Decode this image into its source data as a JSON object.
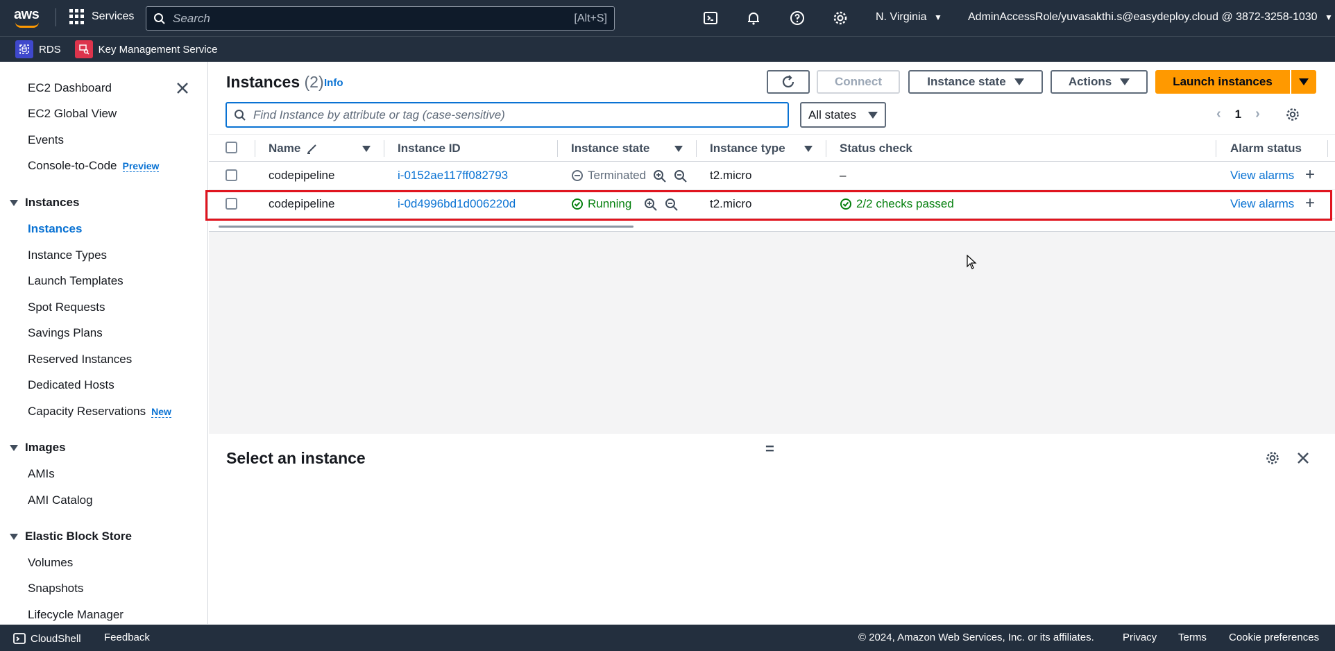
{
  "topnav": {
    "logo_text": "aws",
    "services_label": "Services",
    "search_placeholder": "Search",
    "search_shortcut": "[Alt+S]",
    "region": "N. Virginia",
    "account": "AdminAccessRole/yuvasakthi.s@easydeploy.cloud @ 3872-3258-1030"
  },
  "favorites": [
    {
      "label": "RDS",
      "icon": "rds-icon",
      "color": "#3f48cc"
    },
    {
      "label": "Key Management Service",
      "icon": "kms-icon",
      "color": "#dd344c"
    }
  ],
  "sidebar": {
    "top_items": [
      "EC2 Dashboard",
      "EC2 Global View",
      "Events",
      "Console-to-Code"
    ],
    "preview_badge": "Preview",
    "sections": [
      {
        "title": "Instances",
        "items": [
          "Instances",
          "Instance Types",
          "Launch Templates",
          "Spot Requests",
          "Savings Plans",
          "Reserved Instances",
          "Dedicated Hosts",
          "Capacity Reservations"
        ]
      },
      {
        "title": "Images",
        "items": [
          "AMIs",
          "AMI Catalog"
        ]
      },
      {
        "title": "Elastic Block Store",
        "items": [
          "Volumes",
          "Snapshots",
          "Lifecycle Manager"
        ]
      }
    ],
    "new_badge": "New",
    "active_item": "Instances"
  },
  "main": {
    "title": "Instances",
    "count": "(2)",
    "info": "Info",
    "buttons": {
      "connect": "Connect",
      "instance_state": "Instance state",
      "actions": "Actions",
      "launch": "Launch instances"
    },
    "find_placeholder": "Find Instance by attribute or tag (case-sensitive)",
    "state_filter": "All states",
    "page": "1",
    "columns": [
      "Name",
      "Instance ID",
      "Instance state",
      "Instance type",
      "Status check",
      "Alarm status"
    ],
    "rows": [
      {
        "name": "codepipeline",
        "id": "i-0152ae117ff082793",
        "state": "Terminated",
        "type": "t2.micro",
        "status": "–",
        "alarm": "View alarms"
      },
      {
        "name": "codepipeline",
        "id": "i-0d4996bd1d006220d",
        "state": "Running",
        "type": "t2.micro",
        "status": "2/2 checks passed",
        "alarm": "View alarms"
      }
    ],
    "detail_title": "Select an instance",
    "drag_handle": "="
  },
  "footer": {
    "cloudshell": "CloudShell",
    "feedback": "Feedback",
    "copyright": "© 2024, Amazon Web Services, Inc. or its affiliates.",
    "privacy": "Privacy",
    "terms": "Terms",
    "cookies": "Cookie preferences"
  }
}
